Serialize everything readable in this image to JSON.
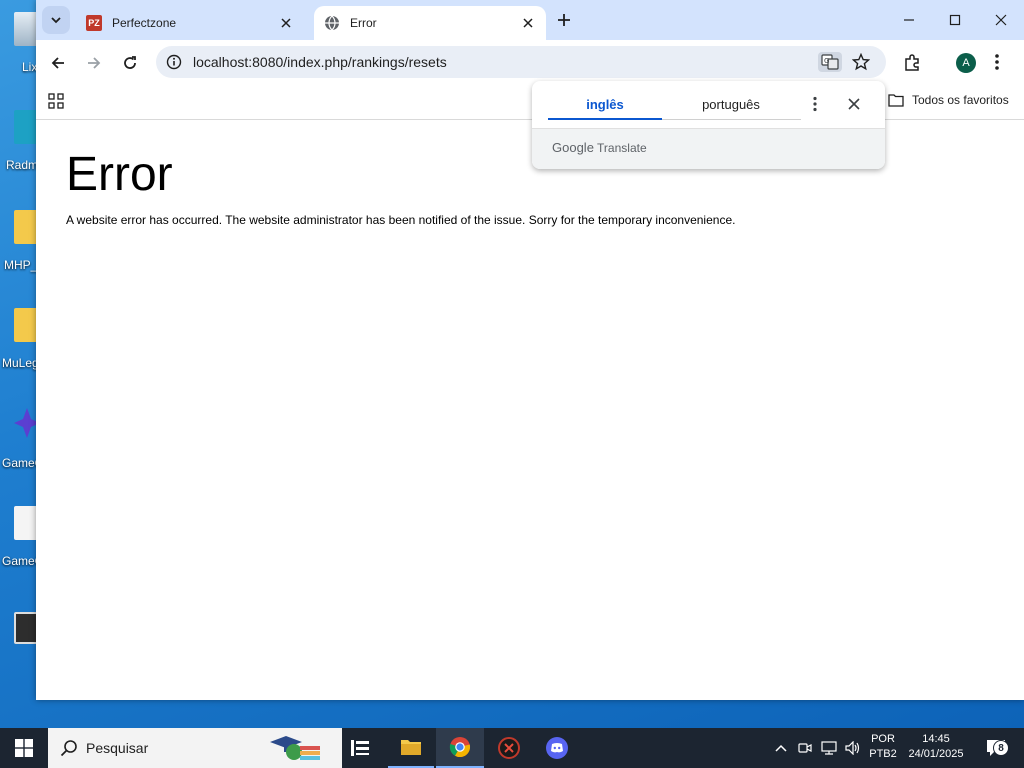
{
  "desktop": {
    "icons": [
      {
        "label": "Lix"
      },
      {
        "label": "Radm"
      },
      {
        "label": "MHP_"
      },
      {
        "label": "MuLeg"
      },
      {
        "label": "GameC"
      },
      {
        "label": "GameC"
      },
      {
        "label": ""
      }
    ]
  },
  "browser": {
    "tabs": [
      {
        "title": "Perfectzone",
        "favicon_text": "PZ",
        "favicon_color": "#c0392b"
      },
      {
        "title": "Error"
      }
    ],
    "url": "localhost:8080/index.php/rankings/resets",
    "bookmarks_label": "Todos os favoritos",
    "profile_initial": "A"
  },
  "translate_popup": {
    "source_lang": "inglês",
    "target_lang": "português",
    "footer_brand": "Google",
    "footer_product": "Translate"
  },
  "page": {
    "heading": "Error",
    "message": "A website error has occurred. The website administrator has been notified of the issue. Sorry for the temporary inconvenience."
  },
  "taskbar": {
    "search_placeholder": "Pesquisar",
    "language": "POR",
    "keyboard": "PTB2",
    "time": "14:45",
    "date": "24/01/2025",
    "notification_count": "8"
  },
  "colors": {
    "accent": "#0b57d0",
    "tabstrip": "#d3e3fd",
    "taskbar": "#1c2531"
  }
}
